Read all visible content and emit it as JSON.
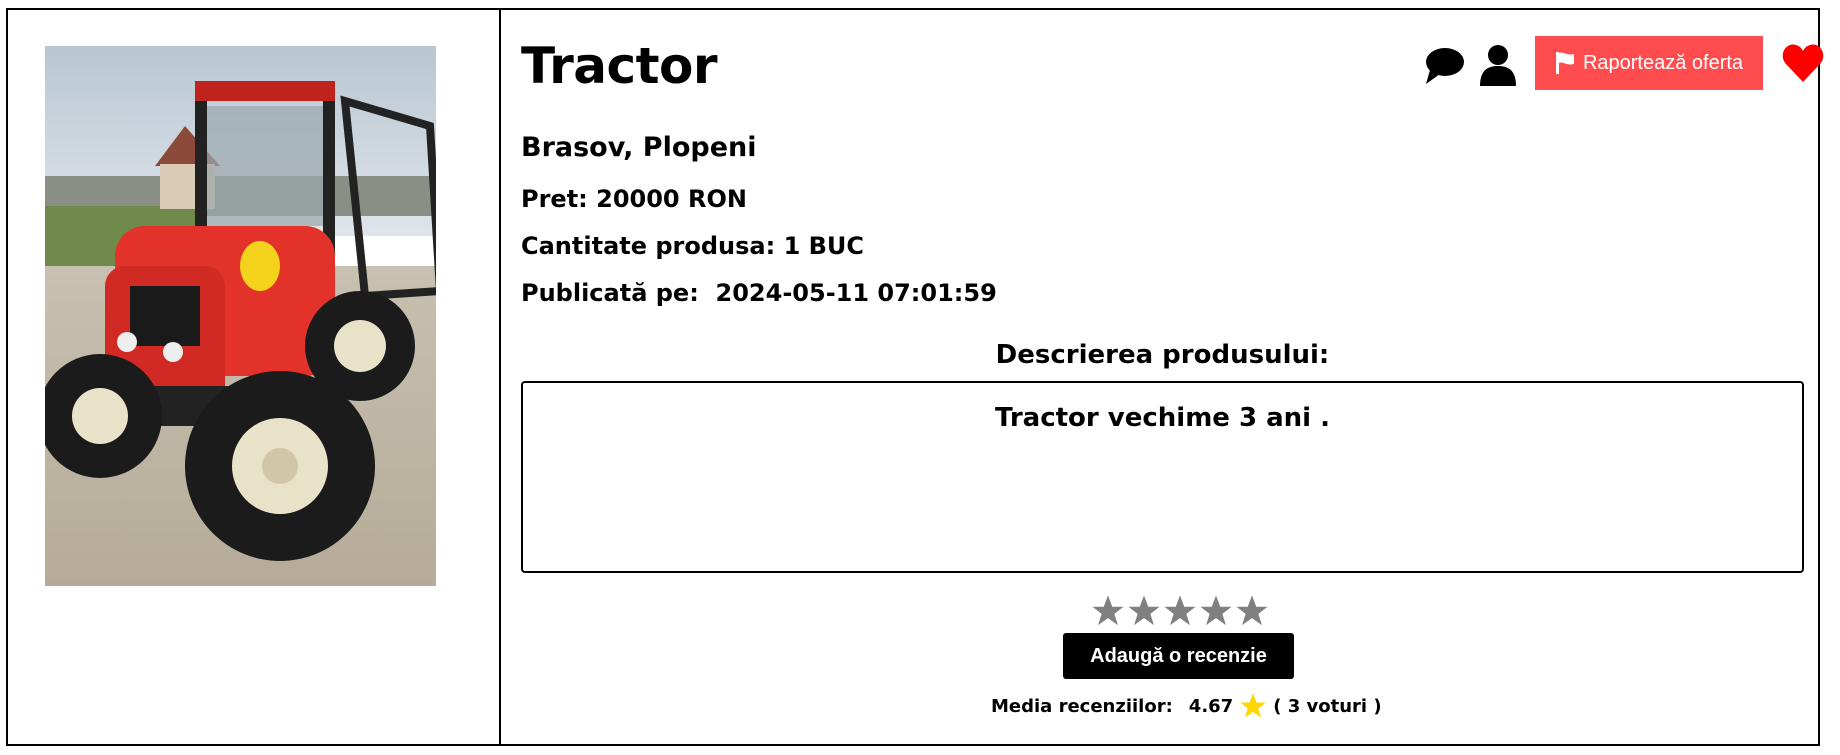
{
  "product": {
    "title": "Tractor",
    "location": "Brasov, Plopeni",
    "price": "Pret: 20000 RON",
    "quantity": "Cantitate produsa: 1 BUC",
    "published_label": "Publicată pe:",
    "published_value": "2024-05-11 07:01:59",
    "image_alt": "Tractor photo"
  },
  "actions": {
    "chat_icon": "chat-bubble-icon",
    "user_icon": "user-icon",
    "report_label": "Raportează oferta",
    "report_icon": "flag-icon",
    "favorite_icon": "heart-icon"
  },
  "description": {
    "heading": "Descrierea produsului:",
    "text": "Tractor vechime 3 ani ."
  },
  "reviews": {
    "stars_total": 5,
    "add_review_label": "Adaugă o recenzie",
    "avg_label": "Media recenziilor:",
    "avg_value": "4.67",
    "votes": "( 3 voturi  )"
  },
  "colors": {
    "report_bg": "#ff4d4f",
    "heart": "#ff0000",
    "star_empty": "#808080",
    "star_filled": "#ffd700"
  }
}
